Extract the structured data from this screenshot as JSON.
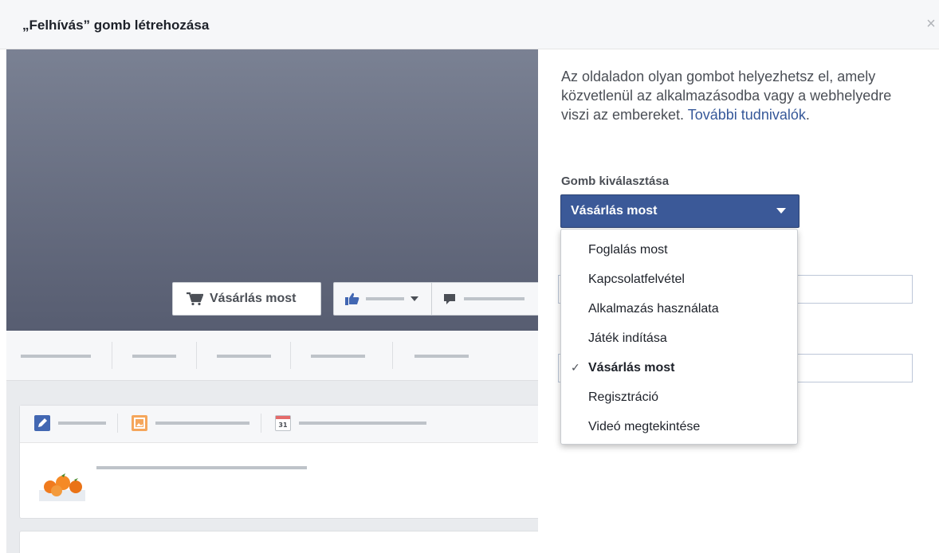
{
  "dialog": {
    "title": "„Felhívás” gomb létrehozása",
    "close_label": "×"
  },
  "preview": {
    "cta_button_label": "Vásárlás most",
    "calendar_icon_text": "31"
  },
  "panel": {
    "description": "Az oldaladon olyan gombot helyezhetsz el, amely közvetlenül az alkalmazásodba vagy a webhelyedre viszi az embereket.",
    "learn_more_link": "További tudnivalók",
    "learn_more_suffix": ".",
    "select_label": "Gomb kiválasztása",
    "selected_value": "Vásárlás most",
    "check_mark": "✓",
    "options": [
      {
        "label": "Foglalás most",
        "selected": false
      },
      {
        "label": "Kapcsolatfelvétel",
        "selected": false
      },
      {
        "label": "Alkalmazás használata",
        "selected": false
      },
      {
        "label": "Játék indítása",
        "selected": false
      },
      {
        "label": "Vásárlás most",
        "selected": true
      },
      {
        "label": "Regisztráció",
        "selected": false
      },
      {
        "label": "Videó megtekintése",
        "selected": false
      }
    ]
  },
  "colors": {
    "facebook_blue": "#3b5998",
    "link_blue": "#365899",
    "cover_top": "#7a8193",
    "cover_bottom": "#575d71"
  }
}
